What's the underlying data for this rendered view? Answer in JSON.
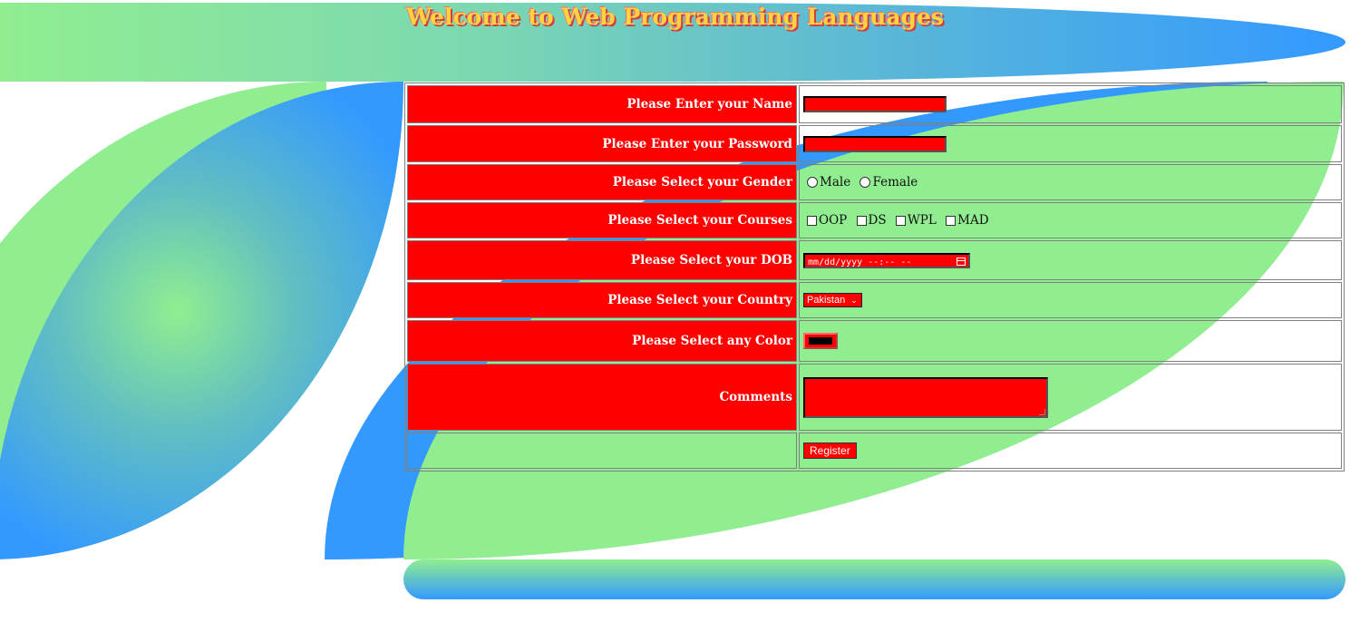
{
  "header": {
    "title": "Welcome to Web Programming Languages"
  },
  "form": {
    "name_label": "Please Enter your Name",
    "password_label": "Please Enter your Password",
    "gender_label": "Please Select your Gender",
    "gender_options": [
      "Male",
      "Female"
    ],
    "courses_label": "Please Select your Courses",
    "course_options": [
      "OOP",
      "DS",
      "WPL",
      "MAD"
    ],
    "dob_label": "Please Select your DOB",
    "dob_placeholder": "mm/dd/yyyy --:-- --",
    "country_label": "Please Select your Country",
    "country_selected": "Pakistan",
    "color_label": "Please Select any Color",
    "color_value": "#000000",
    "comments_label": "Comments",
    "register_label": "Register"
  },
  "colors": {
    "label_bg": "#ff0000",
    "accent_green": "#90ee90",
    "accent_blue": "#3399ff",
    "title_color": "#ffd23f"
  }
}
